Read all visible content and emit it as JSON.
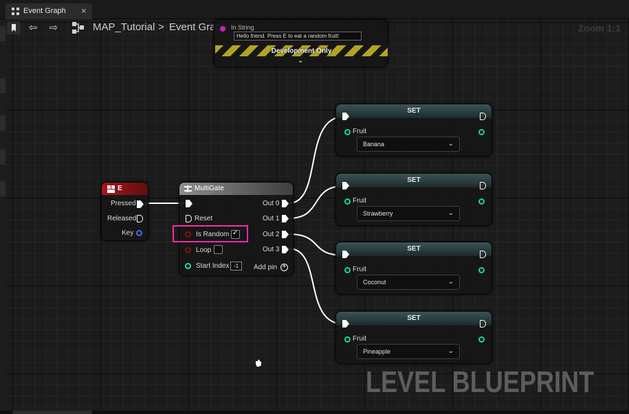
{
  "tab": {
    "label": "Event Graph",
    "close": "×"
  },
  "nav": {
    "back": "⇦",
    "forward": "⇨",
    "breadcrumb_root": "MAP_Tutorial",
    "breadcrumb_sep": ">",
    "breadcrumb_current": "Event Graph",
    "zoom": "Zoom 1:1"
  },
  "print_node": {
    "in_string_label": "In String",
    "in_string_value": "Hello friend. Press E to eat a random fruit!",
    "dev_banner": "Development Only",
    "expand": "⌄"
  },
  "event_node": {
    "title": "E",
    "pins": [
      "Pressed",
      "Released",
      "Key"
    ]
  },
  "multigate": {
    "title": "MultiGate",
    "inputs": {
      "reset": "Reset",
      "is_random": "Is Random",
      "loop": "Loop",
      "start_index": "Start Index"
    },
    "is_random_checked": true,
    "loop_checked": false,
    "start_index_value": "-1",
    "is_random_check_glyph": "✓",
    "outputs": [
      "Out 0",
      "Out 1",
      "Out 2",
      "Out 3"
    ],
    "add_pin": "Add pin",
    "add_glyph": "+"
  },
  "set_nodes": [
    {
      "title": "SET",
      "var": "Fruit",
      "value": "Banana"
    },
    {
      "title": "SET",
      "var": "Fruit",
      "value": "Strawberry"
    },
    {
      "title": "SET",
      "var": "Fruit",
      "value": "Coconut"
    },
    {
      "title": "SET",
      "var": "Fruit",
      "value": "Pineapple"
    }
  ],
  "combo_chevron": "⌄",
  "watermark": "LEVEL BLUEPRINT",
  "colors": {
    "exec": "#ffffff",
    "event_header": "#a9161a",
    "variable_pin": "#0fd9a5",
    "boolean_pin": "#8b0e0e",
    "key_pin": "#3a6ff2",
    "int_pin": "#2ed9a0",
    "highlight": "#ff2aa8",
    "hazard": "#b1a520"
  }
}
